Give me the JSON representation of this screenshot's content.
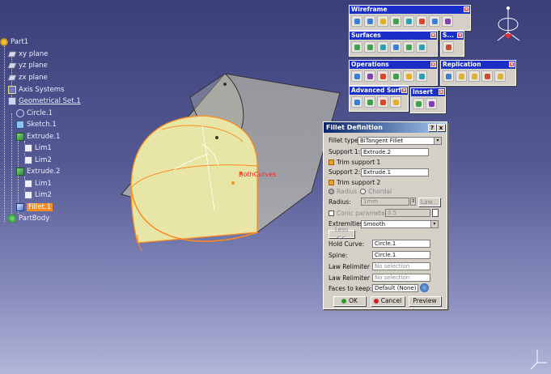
{
  "tree": {
    "items": [
      {
        "label": "Part1",
        "icon": "part-icon"
      },
      {
        "label": "xy plane",
        "icon": "plane-icon"
      },
      {
        "label": "yz plane",
        "icon": "plane-icon"
      },
      {
        "label": "zx plane",
        "icon": "plane-icon"
      },
      {
        "label": "Axis Systems",
        "icon": "axis-systems-icon"
      },
      {
        "label": "Geometrical Set.1",
        "icon": "geometrical-set-icon"
      },
      {
        "label": "Circle.1",
        "icon": "circle-icon"
      },
      {
        "label": "Sketch.1",
        "icon": "sketch-icon"
      },
      {
        "label": "Extrude.1",
        "icon": "extrude-icon"
      },
      {
        "label": "Lim1",
        "icon": "limit-icon"
      },
      {
        "label": "Lim2",
        "icon": "limit-icon"
      },
      {
        "label": "Extrude.2",
        "icon": "extrude-icon"
      },
      {
        "label": "Lim1",
        "icon": "limit-icon"
      },
      {
        "label": "Lim2",
        "icon": "limit-icon"
      },
      {
        "label": "Fillet.1",
        "icon": "fillet-icon"
      },
      {
        "label": "PartBody",
        "icon": "partbody-icon"
      }
    ]
  },
  "toolbars": {
    "wireframe": "Wireframe",
    "surfaces": "Surfaces",
    "s_short": "S...",
    "operations": "Operations",
    "replication": "Replication",
    "advanced": "Advanced Surf...",
    "insert": "Insert",
    "close_glyph": "x"
  },
  "viewport": {
    "label": "BothCurves"
  },
  "dialog": {
    "title": "Fillet Definition",
    "help_glyph": "?",
    "close_glyph": "x",
    "fillet_type_label": "Fillet type:",
    "fillet_type_value": "BiTangent Fillet",
    "support1_label": "Support 1:",
    "support1_value": "Extrude.2",
    "trim_support1": "Trim support 1",
    "support2_label": "Support 2:",
    "support2_value": "Extrude.1",
    "trim_support2": "Trim support 2",
    "radius_option": "Radius",
    "chordal_option": "Chordal",
    "radius_label": "Radius:",
    "radius_value": "1mm",
    "law_button": "Law...",
    "conic_label": "Conic parameter:",
    "conic_value": "0.5",
    "extremities_label": "Extremities:",
    "extremities_value": "Smooth",
    "less_button": "Less <<",
    "hold_curve_label": "Hold Curve:",
    "hold_curve_value": "Circle.1",
    "spine_label": "Spine:",
    "spine_value": "Circle.1",
    "law_relimiter1_label": "Law Relimiter 1:",
    "law_relimiter1_value": "No selection",
    "law_relimiter2_label": "Law Relimiter 2:",
    "law_relimiter2_value": "No selection",
    "faces_label": "Faces to keep:",
    "faces_value": "Default (None)",
    "ok_label": "OK",
    "cancel_label": "Cancel",
    "preview_label": "Preview"
  },
  "colors": {
    "selected": "#ff8a1e",
    "title_bar": "#1a2fc8",
    "surface_fill": "#e8e6a6",
    "highlight_curve": "#ff8a1e"
  }
}
